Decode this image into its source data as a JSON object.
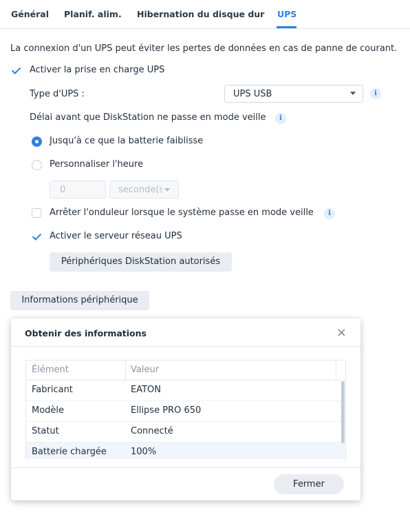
{
  "tabs": [
    {
      "label": "Général"
    },
    {
      "label": "Planif. alim."
    },
    {
      "label": "Hibernation du disque dur"
    },
    {
      "label": "UPS",
      "active": true
    }
  ],
  "ups": {
    "description": "La connexion d'un UPS peut éviter les pertes de données en cas de panne de courant.",
    "enable_label": "Activer la prise en charge UPS",
    "enable_checked": true,
    "type_label": "Type d'UPS :",
    "type_value": "UPS USB",
    "delay_label": "Délai avant que DiskStation ne passe en mode veille",
    "radio_low_battery": "Jusqu'à ce que la batterie faiblisse",
    "radio_custom": "Personnaliser l'heure",
    "custom_value": "0",
    "unit_value": "seconde(s)",
    "shutdown_label": "Arrêter l'onduleur lorsque le système passe en mode veille",
    "shutdown_checked": false,
    "network_server_label": "Activer le serveur réseau UPS",
    "network_server_checked": true,
    "permitted_devices_button": "Périphériques DiskStation autorisés",
    "device_info_button": "Informations périphérique",
    "info_glyph": "i"
  },
  "dialog": {
    "title": "Obtenir des informations",
    "close_glyph": "×",
    "columns": [
      "Élément",
      "Valeur"
    ],
    "rows": [
      {
        "item": "Fabricant",
        "value": "EATON"
      },
      {
        "item": "Modèle",
        "value": "Ellipse PRO 650"
      },
      {
        "item": "Statut",
        "value": "Connecté"
      },
      {
        "item": "Batterie chargée",
        "value": "100%"
      }
    ],
    "close_button": "Fermer"
  },
  "colors": {
    "accent": "#2f7fe0",
    "text": "#1f2d3d",
    "button_bg": "#e9edf1"
  }
}
